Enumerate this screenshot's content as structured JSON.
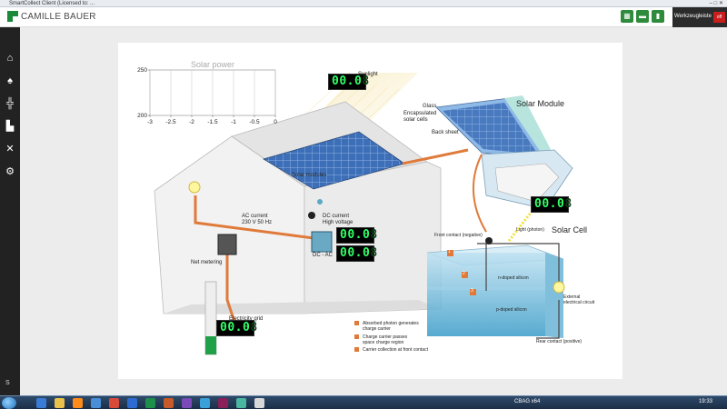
{
  "window": {
    "title": "SmartCollect Client (Licensed to: ...",
    "controls": "–  □  ✕"
  },
  "header": {
    "brand": "CAMILLE BAUER",
    "tools_label": "Werkzeugleiste",
    "power_label": "off",
    "buttons": [
      "grid-icon",
      "chat-icon",
      "battery-icon"
    ]
  },
  "sidebar": {
    "items": [
      "home-icon",
      "alert-icon",
      "plant-icon",
      "factory-icon",
      "tools-icon",
      "settings-icon"
    ],
    "bottom_label": "S"
  },
  "chart_data": {
    "type": "line",
    "title": "Solar power",
    "x": [],
    "series": [],
    "xlim": [
      -3,
      0
    ],
    "ylim": [
      200,
      250
    ],
    "xticks": [
      "-3",
      "-2.5",
      "-2",
      "-1.5",
      "-1",
      "-0.5",
      "0"
    ],
    "yticks": [
      "250",
      "200"
    ],
    "grid": true
  },
  "displays": {
    "sunlight": {
      "value": "00.0",
      "ghost": "8"
    },
    "photon": {
      "value": "00.0",
      "ghost": "8"
    },
    "dc_current": {
      "value": "00.0",
      "ghost": "8"
    },
    "ac_output": {
      "value": "00.0",
      "ghost": "8"
    },
    "grid": {
      "value": "00.0",
      "ghost": "8"
    }
  },
  "labels": {
    "sunlight": "Sunlight",
    "solar_module": "Solar Module",
    "glass": "Glass",
    "encapsulated": "Encapsulated",
    "solar_cells": "solar cells",
    "back_sheet": "Back sheet",
    "solar_modules": "Solar modules",
    "dc_current": "DC current",
    "high_voltage": "High voltage",
    "dc_ac": "DC - AC",
    "ac_current": "AC current",
    "ac_spec": "230 V   50 Hz",
    "net_metering": "Net metering",
    "electricity_grid": "Electricity grid",
    "solar_cell": "Solar Cell",
    "front_contact": "Front contact (negative)",
    "light_photon": "Light (photon)",
    "n_doped": "n-doped silicon",
    "p_doped": "p-doped silicon",
    "external_circuit_1": "External",
    "external_circuit_2": "electrical circuit",
    "rear_contact": "Rear contact (positive)",
    "legend_1a": "Absorbed photon generates",
    "legend_1b": "charge carrier",
    "legend_2a": "Charge carrier passes",
    "legend_2b": "space charge region",
    "legend_3": "Carrier collection at front contact",
    "n1": "1",
    "n2": "2",
    "n3": "3"
  },
  "taskbar": {
    "tray_text": "CBAG x64",
    "clock": "19:33"
  },
  "colors": {
    "brand_green": "#2e8b3c",
    "wire": "#e07a3a",
    "display_green": "#33ff66"
  }
}
